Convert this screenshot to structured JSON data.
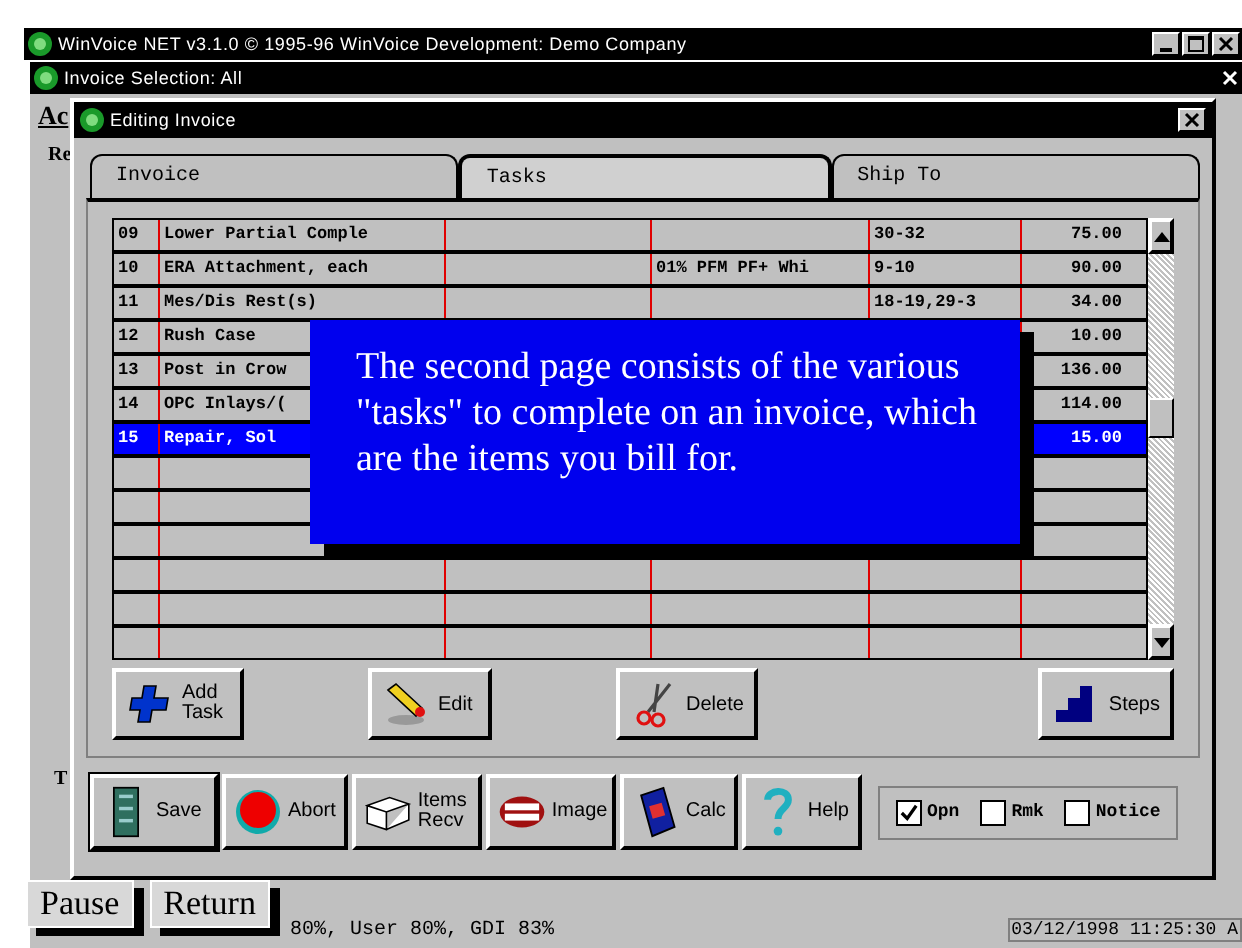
{
  "app_window": {
    "title": "WinVoice NET v3.1.0 © 1995-96 WinVoice Development: Demo Company"
  },
  "selection_window": {
    "title": "Invoice Selection: All",
    "fragments": [
      "Ac",
      "Re",
      "T"
    ]
  },
  "dialog": {
    "title": "Editing Invoice",
    "tabs": [
      {
        "label": "Invoice",
        "selected": false
      },
      {
        "label": "Tasks",
        "selected": true
      },
      {
        "label": "Ship To",
        "selected": false
      }
    ],
    "rows": [
      {
        "num": "09",
        "description": "Lower Partial Comple",
        "column_5": "30-32",
        "amount": "75.00",
        "selected": false
      },
      {
        "num": "10",
        "description": "ERA Attachment, each",
        "column_4": "01% PFM PF+ Whi",
        "column_5": "9-10",
        "amount": "90.00",
        "selected": false
      },
      {
        "num": "11",
        "description": "Mes/Dis Rest(s)",
        "column_5": "18-19,29-3",
        "amount": "34.00",
        "selected": false
      },
      {
        "num": "12",
        "description": "Rush Case",
        "amount": "10.00",
        "selected": false
      },
      {
        "num": "13",
        "description": "Post in Crow",
        "amount": "136.00",
        "selected": false
      },
      {
        "num": "14",
        "description": "OPC Inlays/(",
        "amount": "114.00",
        "selected": false
      },
      {
        "num": "15",
        "description": "Repair, Sol",
        "amount": "15.00",
        "selected": true
      }
    ],
    "grid_buttons": [
      {
        "label": "Add Task",
        "kind": "plus"
      },
      {
        "label": "Edit",
        "kind": "pencil"
      },
      {
        "label": "Delete",
        "kind": "scissors"
      },
      {
        "label": "Steps",
        "kind": "steps"
      }
    ],
    "toolbar": [
      {
        "label": "Save",
        "kind": "cabinet"
      },
      {
        "label": "Abort",
        "kind": "stop"
      },
      {
        "label": "Items Recv",
        "kind": "box"
      },
      {
        "label": "Image",
        "kind": "teeth"
      },
      {
        "label": "Calc",
        "kind": "calculator"
      },
      {
        "label": "Help",
        "kind": "question"
      }
    ],
    "flags": [
      {
        "label": "Opn",
        "checked": true
      },
      {
        "label": "Rmk",
        "checked": false
      },
      {
        "label": "Notice",
        "checked": false
      }
    ]
  },
  "callout": {
    "text": "The second page consists of the various \"tasks\" to complete on an invoice, which are the items you bill for."
  },
  "tutorial_buttons": [
    "Pause",
    "Return"
  ],
  "status_bar": {
    "resources": "80%, User 80%, GDI 83%",
    "datetime": "03/12/1998 11:25:30 A"
  }
}
